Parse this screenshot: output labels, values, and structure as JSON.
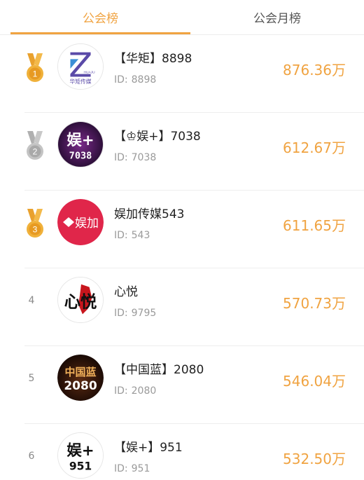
{
  "tabs": [
    {
      "label": "公会榜",
      "active": true
    },
    {
      "label": "公会月榜",
      "active": false
    }
  ],
  "colors": {
    "accent": "#f0a341",
    "gold": "#f0b13a",
    "silver": "#bdbdbd",
    "text": "#222222",
    "muted": "#9a9a9a"
  },
  "rows": [
    {
      "rank": "1",
      "medal": "gold",
      "name": "【华矩】8898",
      "id_label": "ID:",
      "id": "8898",
      "score": "876.36万",
      "avatar_icon": "huaju-logo-icon",
      "avatar_text": "华矩传媒",
      "avatar_sub": "HUAJU"
    },
    {
      "rank": "2",
      "medal": "silver",
      "name": "【♔娱+】7038",
      "id_label": "ID:",
      "id": "7038",
      "score": "612.67万",
      "avatar_icon": "yujia-7038-logo-icon",
      "avatar_text": "娱+",
      "avatar_sub": "7038"
    },
    {
      "rank": "3",
      "medal": "gold",
      "name": "娱加传媒543",
      "id_label": "ID:",
      "id": "543",
      "score": "611.65万",
      "avatar_icon": "yujia-red-logo-icon",
      "avatar_text": "娱加"
    },
    {
      "rank": "4",
      "medal": "",
      "name": "心悦",
      "id_label": "ID:",
      "id": "9795",
      "score": "570.73万",
      "avatar_icon": "xinyue-logo-icon",
      "avatar_text": "心悦"
    },
    {
      "rank": "5",
      "medal": "",
      "name": "【中国蓝】2080",
      "id_label": "ID:",
      "id": "2080",
      "score": "546.04万",
      "avatar_icon": "zhongguolan-logo-icon",
      "avatar_text": "中国蓝",
      "avatar_sub": "2080"
    },
    {
      "rank": "6",
      "medal": "",
      "name": "【娱+】951",
      "id_label": "ID:",
      "id": "951",
      "score": "532.50万",
      "avatar_icon": "yujia-951-logo-icon",
      "avatar_text": "娱+",
      "avatar_sub": "951"
    }
  ]
}
